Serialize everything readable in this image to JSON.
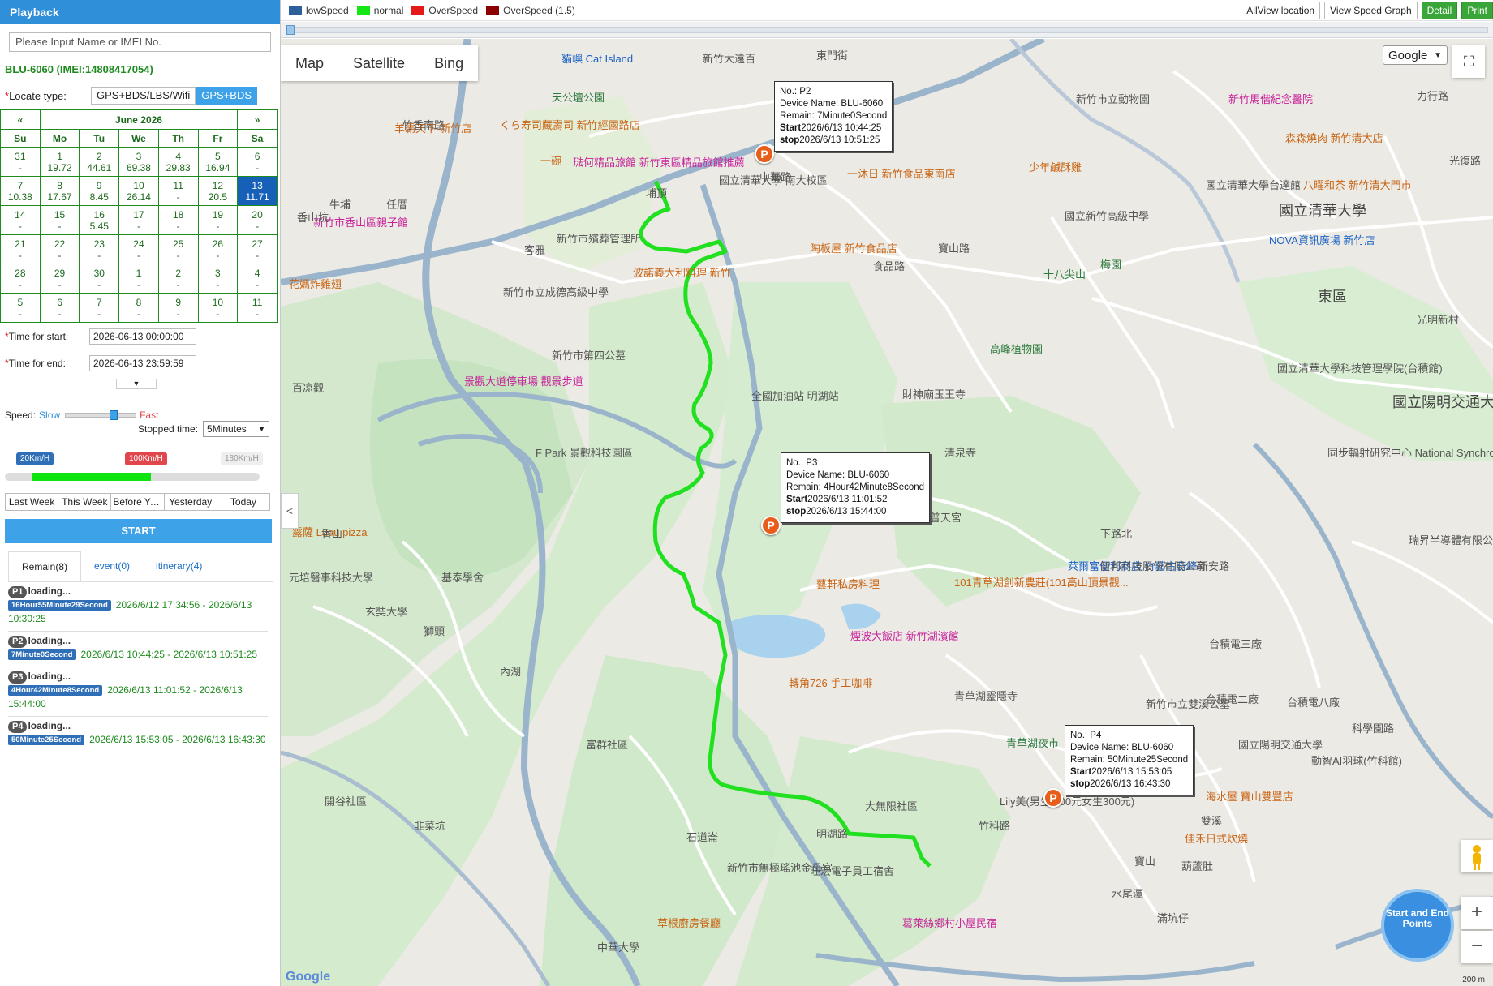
{
  "sidebar": {
    "header": "Playback",
    "search_placeholder": "Please Input Name or IMEI No.",
    "device": "BLU-6060  (IMEI:14808417054)",
    "locate_label": "Locate type:",
    "locate_options": [
      "GPS+BDS/LBS/Wifi",
      "GPS+BDS"
    ],
    "calendar": {
      "prev": "«",
      "next": "»",
      "month": "June 2026",
      "dow": [
        "Su",
        "Mo",
        "Tu",
        "We",
        "Th",
        "Fr",
        "Sa"
      ],
      "weeks": [
        [
          [
            "31",
            "-"
          ],
          [
            "1",
            "19.72"
          ],
          [
            "2",
            "44.61"
          ],
          [
            "3",
            "69.38"
          ],
          [
            "4",
            "29.83"
          ],
          [
            "5",
            "16.94"
          ],
          [
            "6",
            "-"
          ]
        ],
        [
          [
            "7",
            "10.38"
          ],
          [
            "8",
            "17.67"
          ],
          [
            "9",
            "8.45"
          ],
          [
            "10",
            "26.14"
          ],
          [
            "11",
            "-"
          ],
          [
            "12",
            "20.5"
          ],
          [
            "13",
            "11.71"
          ]
        ],
        [
          [
            "14",
            "-"
          ],
          [
            "15",
            "-"
          ],
          [
            "16",
            "5.45"
          ],
          [
            "17",
            "-"
          ],
          [
            "18",
            "-"
          ],
          [
            "19",
            "-"
          ],
          [
            "20",
            "-"
          ]
        ],
        [
          [
            "21",
            "-"
          ],
          [
            "22",
            "-"
          ],
          [
            "23",
            "-"
          ],
          [
            "24",
            "-"
          ],
          [
            "25",
            "-"
          ],
          [
            "26",
            "-"
          ],
          [
            "27",
            "-"
          ]
        ],
        [
          [
            "28",
            "-"
          ],
          [
            "29",
            "-"
          ],
          [
            "30",
            "-"
          ],
          [
            "1",
            "-"
          ],
          [
            "2",
            "-"
          ],
          [
            "3",
            "-"
          ],
          [
            "4",
            "-"
          ]
        ],
        [
          [
            "5",
            "-"
          ],
          [
            "6",
            "-"
          ],
          [
            "7",
            "-"
          ],
          [
            "8",
            "-"
          ],
          [
            "9",
            "-"
          ],
          [
            "10",
            "-"
          ],
          [
            "11",
            "-"
          ]
        ]
      ]
    },
    "time_start_label": "Time for start:",
    "time_start": "2026-06-13 00:00:00",
    "time_end_label": "Time for end:",
    "time_end": "2026-06-13 23:59:59",
    "speed_label": "Speed:",
    "slow": "Slow",
    "fast": "Fast",
    "stopped_label": "Stopped time:",
    "stopped_value": "5Minutes",
    "speed_badges": [
      "20Km/H",
      "100Km/H",
      "180Km/H"
    ],
    "quick": [
      "Last Week",
      "This Week",
      "Before Yesterday",
      "Yesterday",
      "Today"
    ],
    "start": "START",
    "tabs": [
      "Remain(8)",
      "event(0)",
      "itinerary(4)"
    ],
    "remains": [
      {
        "no": "P1",
        "loading": "loading...",
        "duration": "16Hour55Minute29Second",
        "range": "2026/6/12 17:34:56 - 2026/6/13 10:30:25"
      },
      {
        "no": "P2",
        "loading": "loading...",
        "duration": "7Minute0Second",
        "range": "2026/6/13 10:44:25 - 2026/6/13 10:51:25"
      },
      {
        "no": "P3",
        "loading": "loading...",
        "duration": "4Hour42Minute8Second",
        "range": "2026/6/13 11:01:52 - 2026/6/13 15:44:00"
      },
      {
        "no": "P4",
        "loading": "loading...",
        "duration": "50Minute25Second",
        "range": "2026/6/13 15:53:05 - 2026/6/13 16:43:30"
      }
    ]
  },
  "topbar": {
    "legend": [
      {
        "label": "lowSpeed",
        "color": "#2d5f9a"
      },
      {
        "label": "normal",
        "color": "#15e615"
      },
      {
        "label": "OverSpeed",
        "color": "#e41a1a"
      },
      {
        "label": "OverSpeed  (1.5)",
        "color": "#8b0000"
      }
    ],
    "buttons": [
      "AllView location",
      "View Speed Graph",
      "Detail",
      "Print"
    ]
  },
  "map": {
    "types": [
      "Map",
      "Satellite",
      "Bing"
    ],
    "provider": "Google",
    "start_end": "Start and End Points",
    "zoom_in": "+",
    "zoom_out": "−",
    "logo": "Google",
    "scale": "200 m",
    "popups": [
      {
        "no": "No.:  P2",
        "device": "Device Name:  BLU-6060",
        "remain": "Remain:   7Minute0Second",
        "start_label": "Start",
        "start": "2026/6/13 10:44:25",
        "stop_label": "stop",
        "stop": "2026/6/13 10:51:25"
      },
      {
        "no": "No.:  P3",
        "device": "Device Name:  BLU-6060",
        "remain": "Remain:   4Hour42Minute8Second",
        "start_label": "Start",
        "start": "2026/6/13 11:01:52",
        "stop_label": "stop",
        "stop": "2026/6/13 15:44:00"
      },
      {
        "no": "No.:  P4",
        "device": "Device Name:  BLU-6060",
        "remain": "Remain:   50Minute25Second",
        "start_label": "Start",
        "start": "2026/6/13 15:53:05",
        "stop_label": "stop",
        "stop": "2026/6/13 16:43:30"
      }
    ],
    "pin_label": "P",
    "pois": [
      "新竹大遠百",
      "貓嶼 Cat Island",
      "天公壇公園",
      "羊霸天下-新竹店",
      "くら寿司藏壽司 新竹經國路店",
      "一碗",
      "琺何精品旅館 新竹東區精品旅館推薦",
      "國立清華大學 南大校區",
      "新竹市殯葬管理所",
      "波諾義大利料理 新竹",
      "陶板屋 新竹食品店",
      "一沐日 新竹食品東南店",
      "少年鹹酥雞",
      "國立新竹高級中學",
      "新竹市立動物園",
      "新竹馬偕紀念醫院",
      "森森燒肉 新竹清大店",
      "國立清華大學台達館",
      "八曜和茶 新竹清大門市",
      "國立清華大學",
      "NOVA資訊廣場 新竹店",
      "新竹市香山區親子館",
      "花媽炸雞翅",
      "新竹市立成德高級中學",
      "新竹市第四公墓",
      "全國加油站 明湖站",
      "財神廟玉王寺",
      "十八尖山",
      "梅園",
      "高峰植物園",
      "國立清華大學科技管理學院(台積館)",
      "國立陽明交通大學",
      "同步輻射研究中心 National Synchrotron...",
      "東區",
      "光明新村",
      "景觀大道停車場 觀景步道",
      "百凉觀",
      "F Park 景觀科技園區",
      "清泉寺",
      "普天宮",
      "萊爾富便利商店 竹藝古奇峰",
      "101青草湖創新農莊(101高山頂景觀...",
      "藝軒私房料理",
      "煙波大飯店 新竹湖濱館",
      "轉角726 手工咖啡",
      "青草湖靈隱寺",
      "新竹市立雙溪公墓",
      "青草湖夜市",
      "Lily美(男生 200元女生300元)",
      "海水屋 寶山雙豐店",
      "佳禾日式炊燒",
      "雙溪",
      "寶山",
      "葫蘆肚",
      "水尾潭",
      "滿坑仔",
      "大無限社區",
      "旺宏電子員工宿舍",
      "葛萊絲鄉村小屋民宿",
      "新竹市無極瑤池金母宮",
      "草根廚房餐廳",
      "中華大學",
      "富群社區",
      "開谷社區",
      "韭菜坑",
      "石道崙",
      "露薩 Luau pizza",
      "元培醫事科技大學",
      "基泰學舍",
      "玄奘大學",
      "獅頭",
      "內湖",
      "香山",
      "客雅",
      "竹香南路",
      "牛埔",
      "任厝",
      "埔頂",
      "香山坑",
      "台積電三廠",
      "台積電二廠",
      "台積電八廠",
      "動智AI羽球(竹科館)",
      "瑞昇半導體有限公司",
      "智邦科技股份有限公司",
      "國立陽明交通大學",
      "東門街",
      "中華路",
      "食品路",
      "寶山路",
      "明湖路",
      "下路北",
      "新安路",
      "科學園路",
      "力行路",
      "光復路",
      "竹科路"
    ]
  }
}
